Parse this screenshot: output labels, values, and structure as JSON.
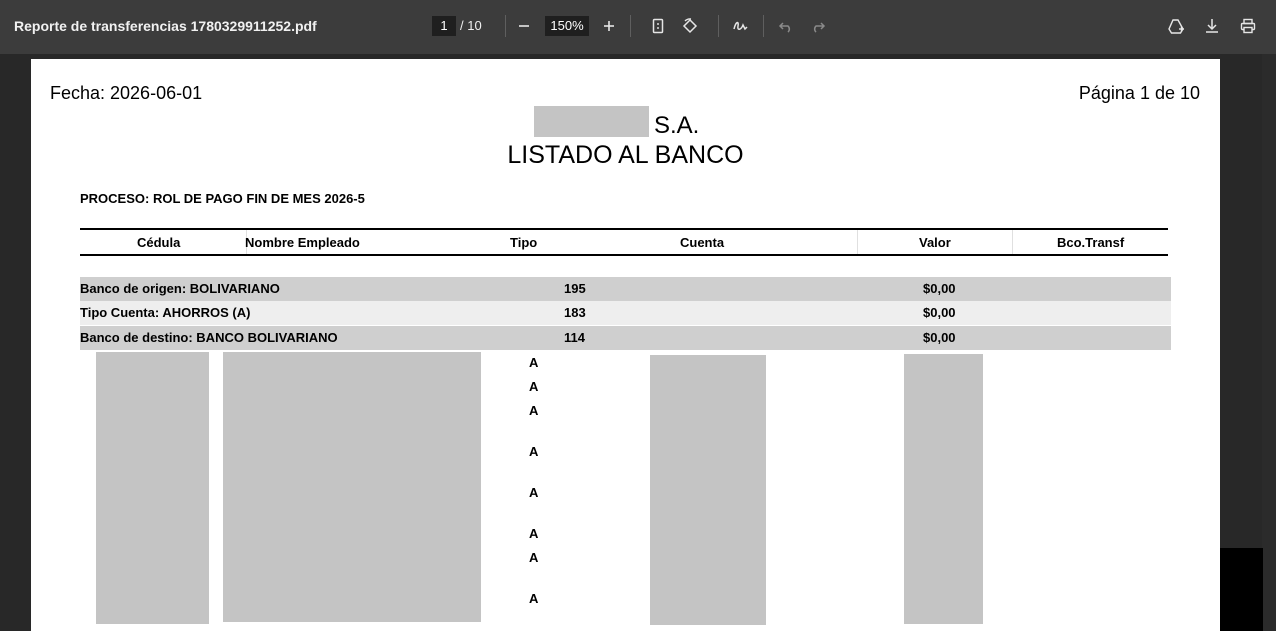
{
  "toolbar": {
    "file_title": "Reporte de transferencias 1780329911252.pdf",
    "current_page": "1",
    "total_pages": "/ 10",
    "zoom": "150%",
    "icons": [
      "zoom-out-icon",
      "zoom-in-icon",
      "fit-page-icon",
      "rotate-icon",
      "draw-icon",
      "undo-icon",
      "redo-icon",
      "add-to-drive-icon",
      "download-icon",
      "print-icon"
    ]
  },
  "document": {
    "date": "Fecha: 2026-06-01",
    "page_label": "Página 1 de 10",
    "company_suffix": "S.A.",
    "report_title": "LISTADO AL BANCO",
    "process": "PROCESO: ROL DE PAGO FIN DE MES 2026-5",
    "columns": [
      "Cédula",
      "Nombre  Empleado",
      "Tipo",
      "Cuenta",
      "Valor",
      "Bco.Transf"
    ],
    "groups": [
      {
        "label": "Banco de origen:   BOLIVARIANO",
        "count": "195",
        "value": "$0,00",
        "shade": "#cfcfcf"
      },
      {
        "label": "Tipo   Cuenta:   AHORROS   (A)",
        "count": "183",
        "value": "$0,00",
        "shade": "#eeeeee"
      },
      {
        "label": "Banco de destino:   BANCO BOLIVARIANO",
        "count": "114",
        "value": "$0,00",
        "shade": "#cfcfcf"
      }
    ],
    "tipo_values": [
      "A",
      "A",
      "A",
      "A",
      "A",
      "A",
      "A",
      "A"
    ]
  }
}
